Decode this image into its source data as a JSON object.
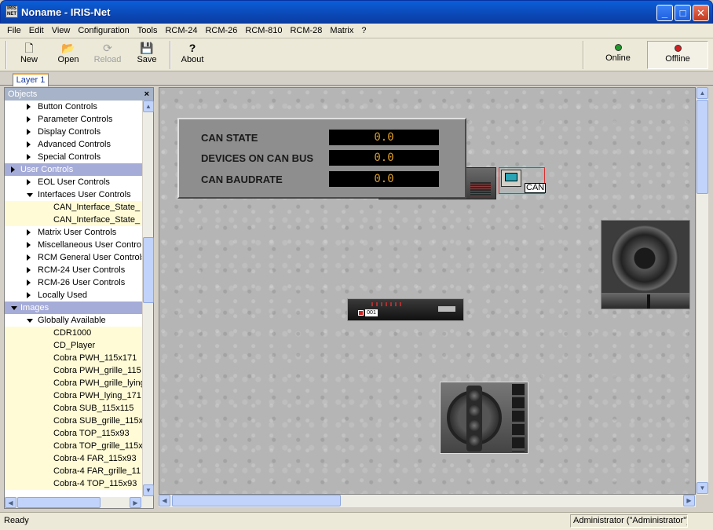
{
  "window": {
    "app_icon_text": "IRIS NET",
    "title": "Noname - IRIS-Net",
    "minimize": "_",
    "maximize": "□",
    "close": "✕"
  },
  "menu": [
    "File",
    "Edit",
    "View",
    "Configuration",
    "Tools",
    "RCM-24",
    "RCM-26",
    "RCM-810",
    "RCM-28",
    "Matrix",
    "?"
  ],
  "toolbar": {
    "new_label": "New",
    "open_label": "Open",
    "reload_label": "Reload",
    "save_label": "Save",
    "about_label": "About",
    "online_label": "Online",
    "offline_label": "Offline",
    "online_led_color": "#1e9a2a",
    "offline_led_color": "#d42020",
    "icons": {
      "new": "document-icon",
      "open": "folder-open-icon",
      "reload": "reload-icon",
      "save": "floppy-disk-icon",
      "about": "question-mark-icon"
    }
  },
  "tabs": [
    {
      "label": "Layer 1"
    }
  ],
  "objects_panel": {
    "header": "Objects",
    "close": "×",
    "rows": [
      {
        "label": "Button Controls",
        "kind": "item",
        "indent": 1,
        "arrow": "right"
      },
      {
        "label": "Parameter Controls",
        "kind": "item",
        "indent": 1,
        "arrow": "right"
      },
      {
        "label": "Display Controls",
        "kind": "item",
        "indent": 1,
        "arrow": "right"
      },
      {
        "label": "Advanced Controls",
        "kind": "item",
        "indent": 1,
        "arrow": "right"
      },
      {
        "label": "Special Controls",
        "kind": "item",
        "indent": 1,
        "arrow": "right"
      },
      {
        "label": "User Controls",
        "kind": "group",
        "indent": 0,
        "arrow": "right"
      },
      {
        "label": "EOL User Controls",
        "kind": "item",
        "indent": 1,
        "arrow": "right"
      },
      {
        "label": "Interfaces User Controls",
        "kind": "item",
        "indent": 1,
        "arrow": "down"
      },
      {
        "label": "CAN_Interface_State_",
        "kind": "leaf",
        "indent": 2,
        "arrow": ""
      },
      {
        "label": "CAN_Interface_State_",
        "kind": "leaf",
        "indent": 2,
        "arrow": ""
      },
      {
        "label": "Matrix User Controls",
        "kind": "item",
        "indent": 1,
        "arrow": "right"
      },
      {
        "label": "Miscellaneous User Contro",
        "kind": "item",
        "indent": 1,
        "arrow": "right"
      },
      {
        "label": "RCM General User Controls",
        "kind": "item",
        "indent": 1,
        "arrow": "right"
      },
      {
        "label": "RCM-24 User Controls",
        "kind": "item",
        "indent": 1,
        "arrow": "right"
      },
      {
        "label": "RCM-26 User Controls",
        "kind": "item",
        "indent": 1,
        "arrow": "right"
      },
      {
        "label": "Locally Used",
        "kind": "item",
        "indent": 1,
        "arrow": "right"
      },
      {
        "label": "Images",
        "kind": "group",
        "indent": 0,
        "arrow": "down"
      },
      {
        "label": "Globally Available",
        "kind": "item",
        "indent": 1,
        "arrow": "down"
      },
      {
        "label": "CDR1000",
        "kind": "leaf",
        "indent": 2,
        "arrow": ""
      },
      {
        "label": "CD_Player",
        "kind": "leaf",
        "indent": 2,
        "arrow": ""
      },
      {
        "label": "Cobra PWH_115x171",
        "kind": "leaf",
        "indent": 2,
        "arrow": ""
      },
      {
        "label": "Cobra PWH_grille_115",
        "kind": "leaf",
        "indent": 2,
        "arrow": ""
      },
      {
        "label": "Cobra PWH_grille_lying",
        "kind": "leaf",
        "indent": 2,
        "arrow": ""
      },
      {
        "label": "Cobra PWH_lying_171",
        "kind": "leaf",
        "indent": 2,
        "arrow": ""
      },
      {
        "label": "Cobra SUB_115x115",
        "kind": "leaf",
        "indent": 2,
        "arrow": ""
      },
      {
        "label": "Cobra SUB_grille_115x",
        "kind": "leaf",
        "indent": 2,
        "arrow": ""
      },
      {
        "label": "Cobra TOP_115x93",
        "kind": "leaf",
        "indent": 2,
        "arrow": ""
      },
      {
        "label": "Cobra TOP_grille_115x",
        "kind": "leaf",
        "indent": 2,
        "arrow": ""
      },
      {
        "label": "Cobra-4 FAR_115x93",
        "kind": "leaf",
        "indent": 2,
        "arrow": ""
      },
      {
        "label": "Cobra-4 FAR_grille_11",
        "kind": "leaf",
        "indent": 2,
        "arrow": ""
      },
      {
        "label": "Cobra-4 TOP_115x93",
        "kind": "leaf",
        "indent": 2,
        "arrow": ""
      }
    ]
  },
  "can_panel": {
    "rows": [
      {
        "label": "CAN STATE",
        "value": "0.0"
      },
      {
        "label": "DEVICES ON CAN BUS",
        "value": "0.0"
      },
      {
        "label": "CAN BAUDRATE",
        "value": "0.0"
      }
    ],
    "value_color": "#d89c2a"
  },
  "can_interface": {
    "label": "CAN",
    "icon": "computer-icon"
  },
  "rack_device": {
    "number": "001"
  },
  "statusbar": {
    "left": "Ready",
    "right": "Administrator (\"Administrator\")"
  }
}
